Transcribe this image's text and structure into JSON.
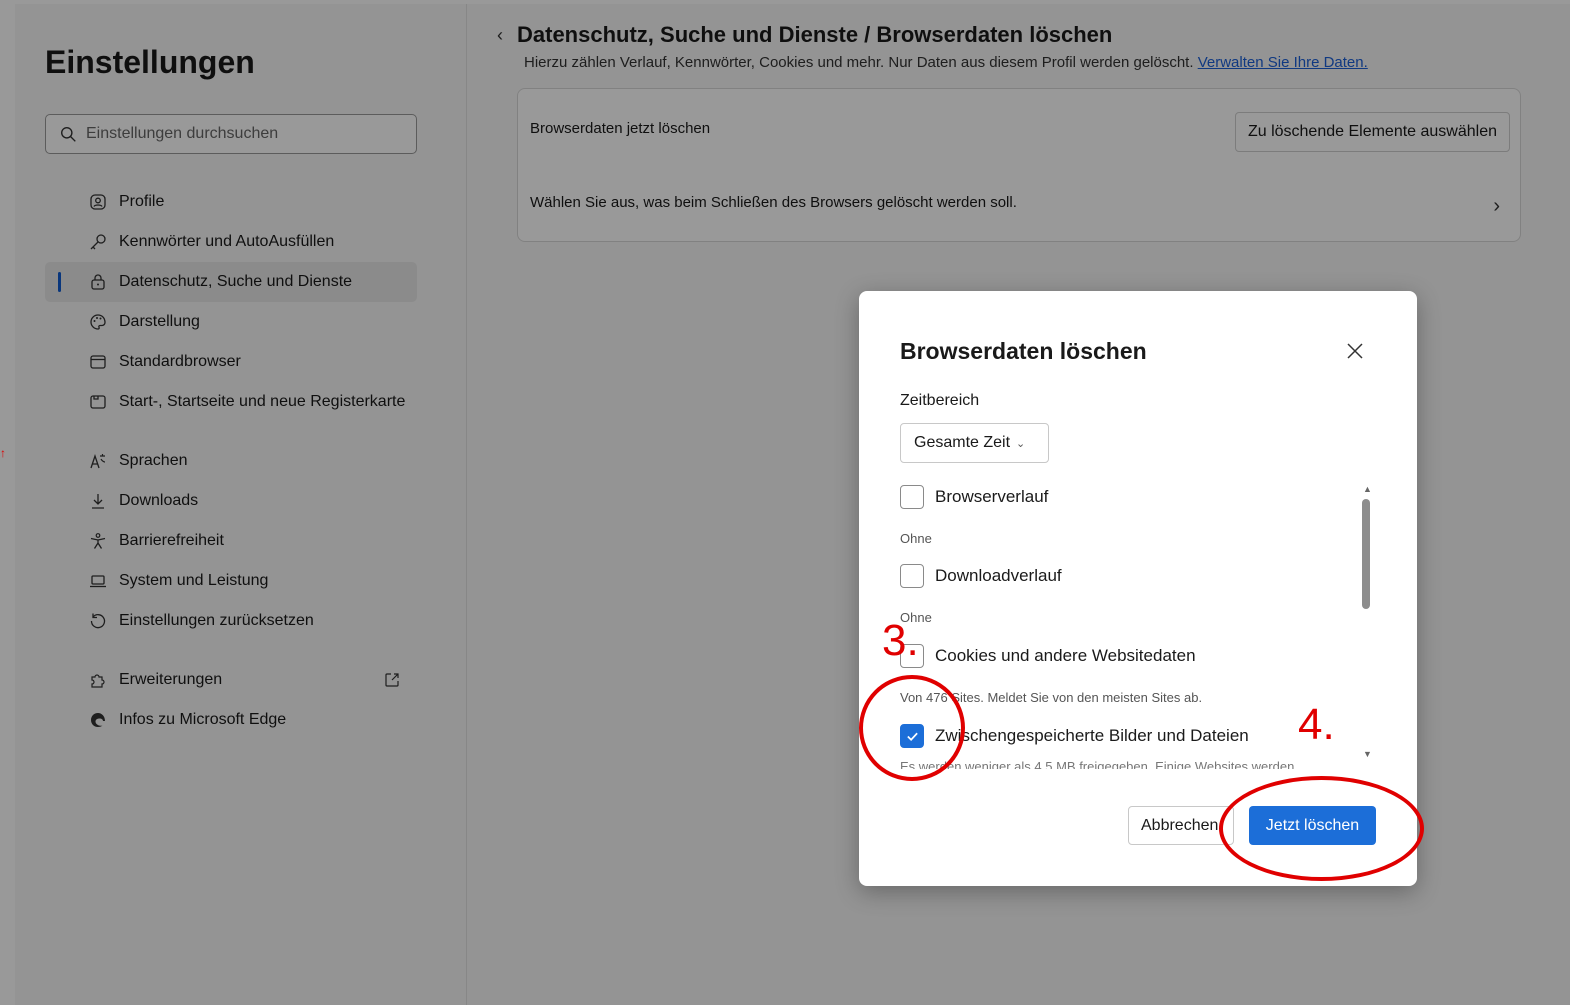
{
  "sidebar": {
    "title": "Einstellungen",
    "search_placeholder": "Einstellungen durchsuchen",
    "items": [
      {
        "label": "Profile",
        "icon": "profile-icon"
      },
      {
        "label": "Kennwörter und AutoAusfüllen",
        "icon": "key-icon"
      },
      {
        "label": "Datenschutz, Suche und Dienste",
        "icon": "lock-icon",
        "active": true
      },
      {
        "label": "Darstellung",
        "icon": "palette-icon"
      },
      {
        "label": "Standardbrowser",
        "icon": "browser-icon"
      },
      {
        "label": "Start-, Startseite und neue Registerkarte",
        "icon": "home-tab-icon"
      },
      {
        "label": "Sprachen",
        "icon": "language-icon"
      },
      {
        "label": "Downloads",
        "icon": "download-icon"
      },
      {
        "label": "Barrierefreiheit",
        "icon": "accessibility-icon"
      },
      {
        "label": "System und Leistung",
        "icon": "laptop-icon"
      },
      {
        "label": "Einstellungen zurücksetzen",
        "icon": "reset-icon"
      },
      {
        "label": "Erweiterungen",
        "icon": "extensions-icon"
      },
      {
        "label": "Infos zu Microsoft Edge",
        "icon": "edge-logo-icon"
      }
    ]
  },
  "header": {
    "breadcrumb": "Datenschutz, Suche und Dienste / Browserdaten löschen",
    "subtitle": "Hierzu zählen Verlauf, Kennwörter, Cookies und mehr. Nur Daten aus diesem Profil werden gelöscht.",
    "subtitle_link": "Verwalten Sie Ihre Daten."
  },
  "card": {
    "row1_label": "Browserdaten jetzt löschen",
    "row1_button": "Zu löschende Elemente auswählen",
    "row2_label": "Wählen Sie aus, was beim Schließen des Browsers gelöscht werden soll."
  },
  "dialog": {
    "title": "Browserdaten löschen",
    "range_label": "Zeitbereich",
    "range_value": "Gesamte Zeit",
    "options": [
      {
        "label": "Browserverlauf",
        "desc": "Ohne",
        "checked": false
      },
      {
        "label": "Downloadverlauf",
        "desc": "Ohne",
        "checked": false
      },
      {
        "label": "Cookies und andere Websitedaten",
        "desc": "Von 476 Sites. Meldet Sie von den meisten Sites ab.",
        "checked": false
      },
      {
        "label": "Zwischengespeicherte Bilder und Dateien",
        "desc": "Es werden weniger als 4,5 MB freigegeben. Einige Websites werden",
        "checked": true
      }
    ],
    "cancel_label": "Abbrechen",
    "confirm_label": "Jetzt löschen"
  },
  "annotations": {
    "step3": "3.",
    "step4": "4.",
    "color": "#e00000"
  },
  "colors": {
    "accent": "#1c6ed8",
    "link": "#1c5fd8"
  }
}
